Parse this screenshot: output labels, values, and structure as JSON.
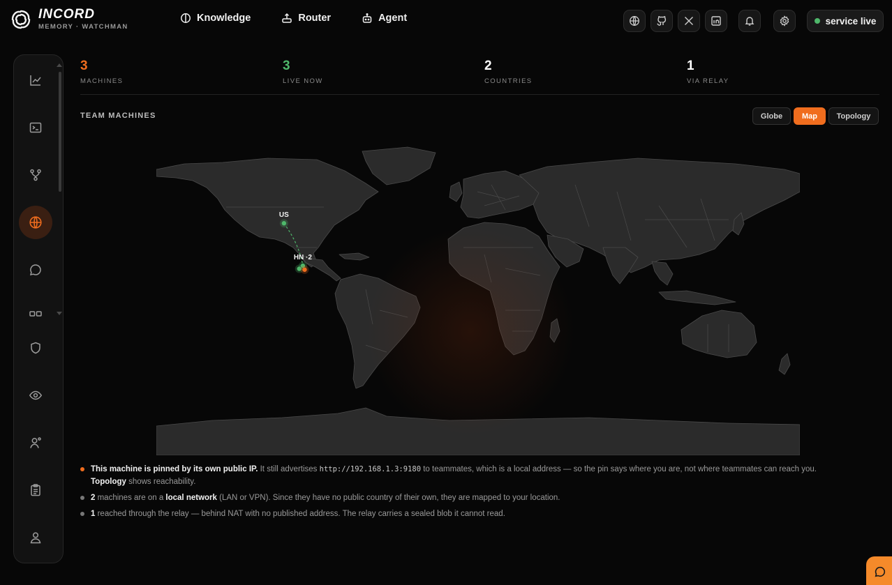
{
  "brand": {
    "name": "INCORD",
    "subtitle": "MEMORY · WATCHMAN"
  },
  "nav": [
    {
      "label": "Knowledge",
      "icon": "brain-icon"
    },
    {
      "label": "Router",
      "icon": "router-icon"
    },
    {
      "label": "Agent",
      "icon": "robot-icon"
    }
  ],
  "header_icons": [
    "globe-icon",
    "github-icon",
    "x-icon",
    "linkedin-icon",
    "bell-icon",
    "settings-icon"
  ],
  "status": {
    "label": "service live",
    "color": "#4fb86b"
  },
  "sidebar": {
    "items": [
      {
        "name": "analytics",
        "icon": "chart-line-icon"
      },
      {
        "name": "terminal",
        "icon": "terminal-icon"
      },
      {
        "name": "branches",
        "icon": "git-branch-icon"
      },
      {
        "name": "globe",
        "icon": "globe-icon",
        "active": true
      },
      {
        "name": "chat",
        "icon": "chat-icon"
      },
      {
        "name": "apps",
        "icon": "grid-icon"
      },
      {
        "name": "shield",
        "icon": "shield-icon"
      },
      {
        "name": "watch",
        "icon": "eye-icon"
      },
      {
        "name": "user-settings",
        "icon": "user-gear-icon"
      },
      {
        "name": "clipboard",
        "icon": "clipboard-icon"
      },
      {
        "name": "profile",
        "icon": "user-icon"
      }
    ]
  },
  "stats": [
    {
      "value": "3",
      "label": "MACHINES",
      "color": "#f06d1e"
    },
    {
      "value": "3",
      "label": "LIVE NOW",
      "color": "#4fb86b"
    },
    {
      "value": "2",
      "label": "COUNTRIES",
      "color": "#ffffff"
    },
    {
      "value": "1",
      "label": "VIA RELAY",
      "color": "#ffffff"
    }
  ],
  "team": {
    "title": "TEAM MACHINES",
    "views": [
      "Globe",
      "Map",
      "Topology"
    ],
    "active_view": "Map"
  },
  "map_pins": [
    {
      "label": "US",
      "lat": 38.5,
      "lon": -97.0,
      "kind": "live"
    },
    {
      "label": "HN ·2",
      "lat": 15.0,
      "lon": -86.5,
      "kind": "live"
    },
    {
      "label": "",
      "lat": 13.3,
      "lon": -88.5,
      "kind": "live"
    },
    {
      "label": "",
      "lat": 12.8,
      "lon": -85.5,
      "kind": "self"
    }
  ],
  "colors": {
    "accent": "#f06d1e",
    "live": "#4fb86b",
    "land": "#2b2b2b",
    "border": "#555555"
  },
  "notes": [
    {
      "bullet_color": "#f06d1e",
      "strong": "This machine is pinned by its own public IP.",
      "text1": " It still advertises ",
      "code": "http://192.168.1.3:9180",
      "text2": " to teammates, which is a local address — so the pin says where you are, not where teammates can reach you.",
      "strong2": "Topology",
      "text3": " shows reachability."
    },
    {
      "bullet_color": "#777777",
      "count": "2",
      "text1": " machines are on a ",
      "strong": "local network",
      "text2": " (LAN or VPN). Since they have no public country of their own, they are mapped to your location."
    },
    {
      "bullet_color": "#777777",
      "count": "1",
      "text1": " reached through the relay — behind NAT with no published address. The relay carries a sealed blob it cannot read."
    }
  ]
}
